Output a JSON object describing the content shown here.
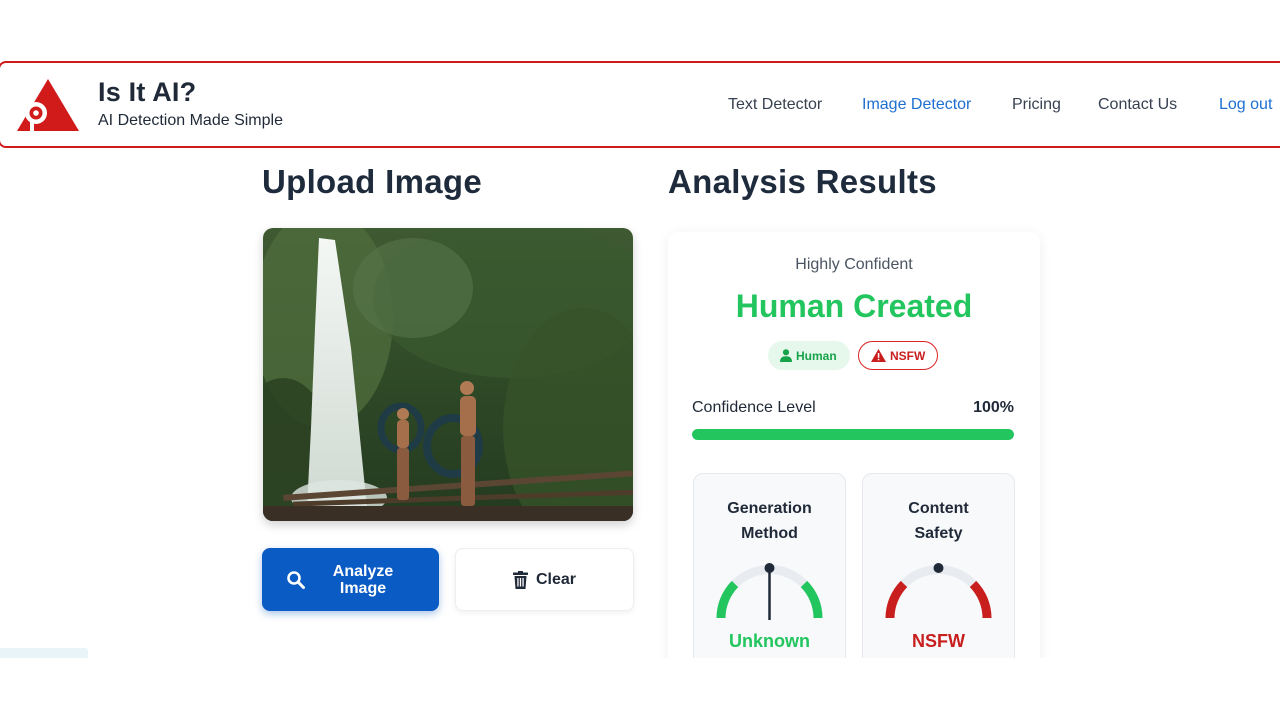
{
  "brand": {
    "title": "Is It AI?",
    "subtitle": "AI Detection Made Simple",
    "logo_icon": "triangle-eye-logo-icon",
    "brand_color": "#d11a1a"
  },
  "nav": {
    "items": [
      {
        "label": "Text Detector",
        "active": false
      },
      {
        "label": "Image Detector",
        "active": true
      },
      {
        "label": "Pricing",
        "active": false
      },
      {
        "label": "Contact Us",
        "active": false
      }
    ],
    "logout_label": "Log out"
  },
  "upload": {
    "title": "Upload Image",
    "analyze_label": "Analyze Image",
    "analyze_icon": "search-icon",
    "clear_label": "Clear",
    "clear_icon": "trash-icon"
  },
  "results": {
    "title": "Analysis Results",
    "confidence_tier": "Highly Confident",
    "verdict": "Human Created",
    "badges": {
      "human": {
        "label": "Human",
        "icon": "user-icon"
      },
      "nsfw": {
        "label": "NSFW",
        "icon": "warning-icon"
      }
    },
    "confidence_label": "Confidence Level",
    "confidence_text": "100%",
    "confidence_fraction": 1.0,
    "metrics": {
      "generation": {
        "title": "Generation Method",
        "value": "Unknown",
        "color": "#22c55e"
      },
      "safety": {
        "title": "Content Safety",
        "value": "NSFW",
        "color": "#c81e1e"
      }
    }
  },
  "colors": {
    "accent_blue": "#0b5bc4",
    "success_green": "#22c55e",
    "danger_red": "#c81e1e"
  }
}
